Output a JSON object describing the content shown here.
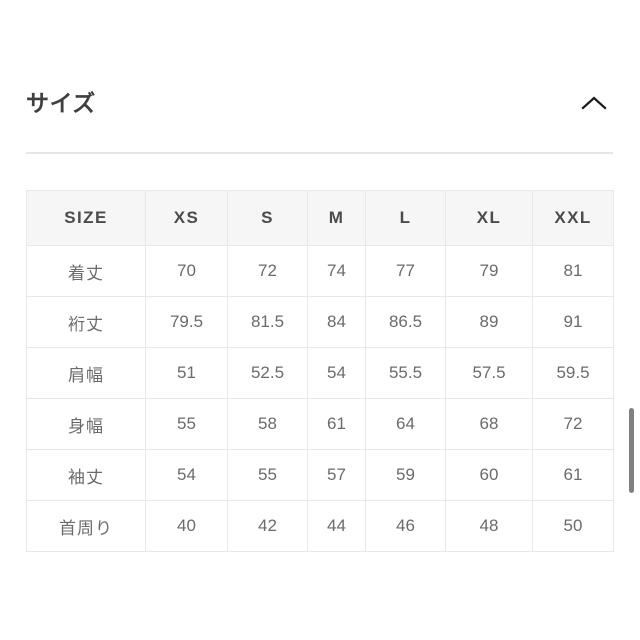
{
  "section": {
    "title": "サイズ",
    "toggle_icon": "chevron-up-icon",
    "expanded": true
  },
  "size_table": {
    "headers": [
      "SIZE",
      "XS",
      "S",
      "M",
      "L",
      "XL",
      "XXL"
    ],
    "rows": [
      {
        "label": "着丈",
        "values": [
          "70",
          "72",
          "74",
          "77",
          "79",
          "81"
        ]
      },
      {
        "label": "裄丈",
        "values": [
          "79.5",
          "81.5",
          "84",
          "86.5",
          "89",
          "91"
        ]
      },
      {
        "label": "肩幅",
        "values": [
          "51",
          "52.5",
          "54",
          "55.5",
          "57.5",
          "59.5"
        ]
      },
      {
        "label": "身幅",
        "values": [
          "55",
          "58",
          "61",
          "64",
          "68",
          "72"
        ]
      },
      {
        "label": "袖丈",
        "values": [
          "54",
          "55",
          "57",
          "59",
          "60",
          "61"
        ]
      },
      {
        "label": "首周り",
        "values": [
          "40",
          "42",
          "44",
          "46",
          "48",
          "50"
        ]
      }
    ]
  },
  "scrollbar": {
    "orientation": "vertical",
    "thumb_color": "#808080"
  },
  "colors": {
    "background": "#ffffff",
    "title_text": "#3f3f3f",
    "table_text": "#6b6b6b",
    "header_background": "#f6f6f6",
    "border": "#e8e8e8",
    "divider": "#e6e6e6"
  }
}
